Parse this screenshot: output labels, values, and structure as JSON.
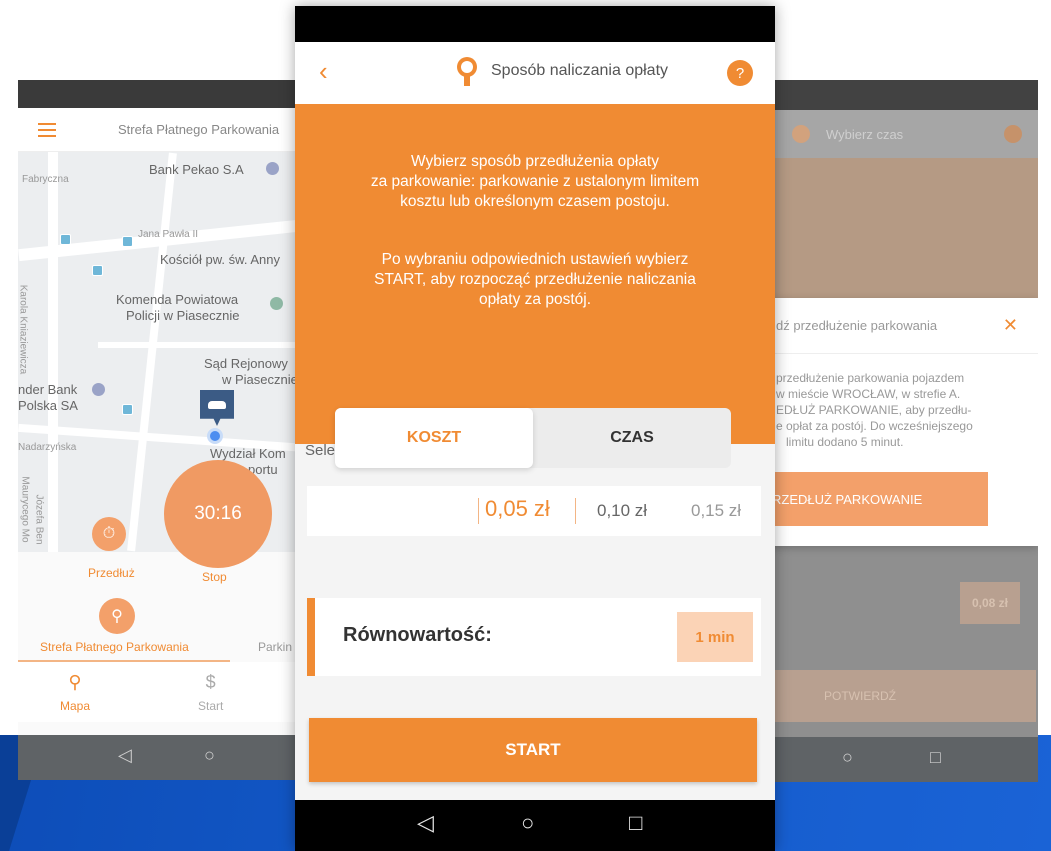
{
  "left_screen": {
    "title": "Strefa Płatnego Parkowania",
    "map_labels": {
      "bank_pekao": "Bank Pekao S.A",
      "fabryczna": "Fabryczna",
      "jana_pawla": "Jana Pawła II",
      "kosciol": "Kościół pw. św. Anny",
      "karola": "Karola Kniaziewicza",
      "komenda_1": "Komenda Powiatowa",
      "komenda_2": "Policji w Piasecznie",
      "sad_1": "Sąd Rejonowy",
      "sad_2": "w Piasecznie",
      "santander_1": "nder Bank",
      "santander_2": "Polska SA",
      "nadarzynska": "Nadarzyńska",
      "wydzial_1": "Wydział Kom",
      "wydzial_2": "portu",
      "maurycego": "Maurycego Mo",
      "jozefa": "Józefa Ben"
    },
    "timer": "30:16",
    "extend_label": "Przedłuż",
    "stop_label": "Stop",
    "tab_active": "Strefa Płatnego Parkowania",
    "tab_other": "Parkin",
    "nav_map": "Mapa",
    "nav_start": "Start"
  },
  "right_screen": {
    "title": "Wybierz czas",
    "dialog_title": "dź przedłużenie parkowania",
    "dialog_text_lines": [
      "przedłużenie parkowania pojazdem",
      "w mieście WROCŁAW, w strefie A.",
      "EDŁUŻ PARKOWANIE, aby przedłu-",
      "e opłat za postój. Do wcześniejszego",
      "limitu dodano 5 minut."
    ],
    "dialog_button": "RZEDŁUŻ PARKOWANIE",
    "price": "0,08 zł",
    "confirm": "POTWIERDŹ"
  },
  "center_screen": {
    "title": "Sposób naliczania opłaty",
    "help": "?",
    "info_paragraph_1": [
      "Wybierz sposób przedłużenia opłaty",
      "za parkowanie: parkowanie z ustalonym limitem",
      "kosztu lub określonym czasem postoju."
    ],
    "info_paragraph_2": [
      "Po wybraniu odpowiednich ustawień wybierz",
      "START, aby rozpocząć przedłużenie naliczania",
      "opłaty za postój."
    ],
    "select_prefix": "Sele",
    "toggle_cost": "KOSZT",
    "toggle_time": "CZAS",
    "amounts": [
      "0,05 zł",
      "0,10 zł",
      "0,15 zł"
    ],
    "equivalent_label": "Równowartość:",
    "equivalent_value": "1 min",
    "start_button": "START"
  },
  "colors": {
    "accent": "#f08b33",
    "accent_light": "#fbd3b6",
    "background_blue": "#1358c7"
  }
}
